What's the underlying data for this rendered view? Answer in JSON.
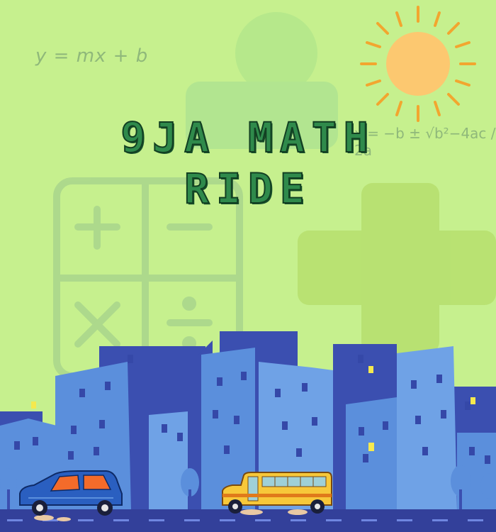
{
  "title": {
    "line1": "9JA MATH",
    "line2": "RIDE"
  },
  "formulas": {
    "linear": "y = mx + b",
    "quadratic": "x = −b ± √b²−4ac / 2a"
  },
  "icons": [
    "sun-icon",
    "calculator-icon",
    "plus-icon",
    "person-icon",
    "car-icon",
    "school-bus-icon"
  ],
  "colors": {
    "background": "#c6f08e",
    "title_fill": "#2f8a4b",
    "title_outline": "#123f22",
    "sun": "#fcc870",
    "building_dark": "#3b4fb0",
    "building_light": "#5b8fdc",
    "road": "#33409a",
    "car": "#2a5fc0",
    "bus": "#f7c83a"
  }
}
